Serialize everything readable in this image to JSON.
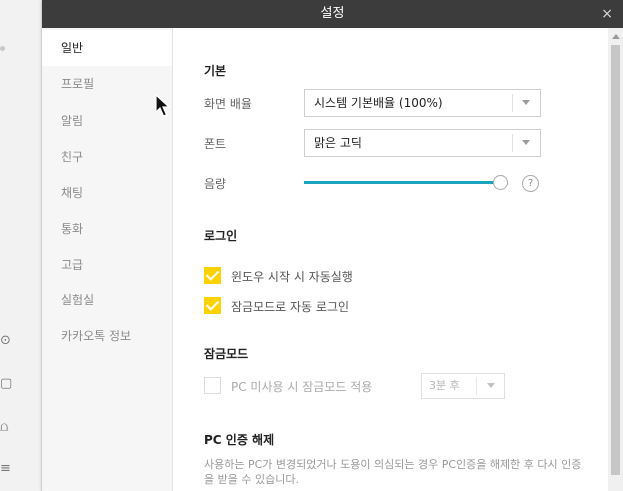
{
  "window": {
    "title": "설정",
    "close_symbol": "×"
  },
  "background_glyphs": [
    "⊙",
    "▢",
    "⩍",
    "≡"
  ],
  "sidebar": {
    "items": [
      {
        "label": "일반",
        "active": true
      },
      {
        "label": "프로필",
        "active": false
      },
      {
        "label": "알림",
        "active": false
      },
      {
        "label": "친구",
        "active": false
      },
      {
        "label": "채팅",
        "active": false
      },
      {
        "label": "통화",
        "active": false
      },
      {
        "label": "고급",
        "active": false
      },
      {
        "label": "실험실",
        "active": false
      },
      {
        "label": "카카오톡 정보",
        "active": false
      }
    ]
  },
  "basic": {
    "title": "기본",
    "zoom": {
      "label": "화면 배율",
      "value": "시스템 기본배율 (100%)"
    },
    "font": {
      "label": "폰트",
      "value": "맑은 고딕"
    },
    "volume": {
      "label": "음량",
      "level_percent": 100,
      "help_symbol": "?"
    }
  },
  "login": {
    "title": "로그인",
    "options": [
      {
        "label": "윈도우 시작 시 자동실행",
        "checked": true
      },
      {
        "label": "잠금모드로 자동 로그인",
        "checked": true
      }
    ]
  },
  "lock_mode": {
    "title": "잠금모드",
    "option": {
      "label": "PC 미사용 시 잠금모드 적용",
      "checked": false,
      "enabled": false
    },
    "delay_value": "3분 후"
  },
  "pc_auth": {
    "title": "PC 인증 해제",
    "description": "사용하는 PC가 변경되었거나 도용이 의심되는 경우 PC인증을 해제한 후 다시 인증을 받을 수 있습니다."
  },
  "colors": {
    "titlebar": "#3c3c3c",
    "accent_checkbox": "#fed100",
    "slider": "#1aa4bf"
  },
  "icons": [
    "close-icon",
    "chevron-down-icon",
    "help-icon",
    "checkmark-icon",
    "mouse-cursor-icon"
  ]
}
